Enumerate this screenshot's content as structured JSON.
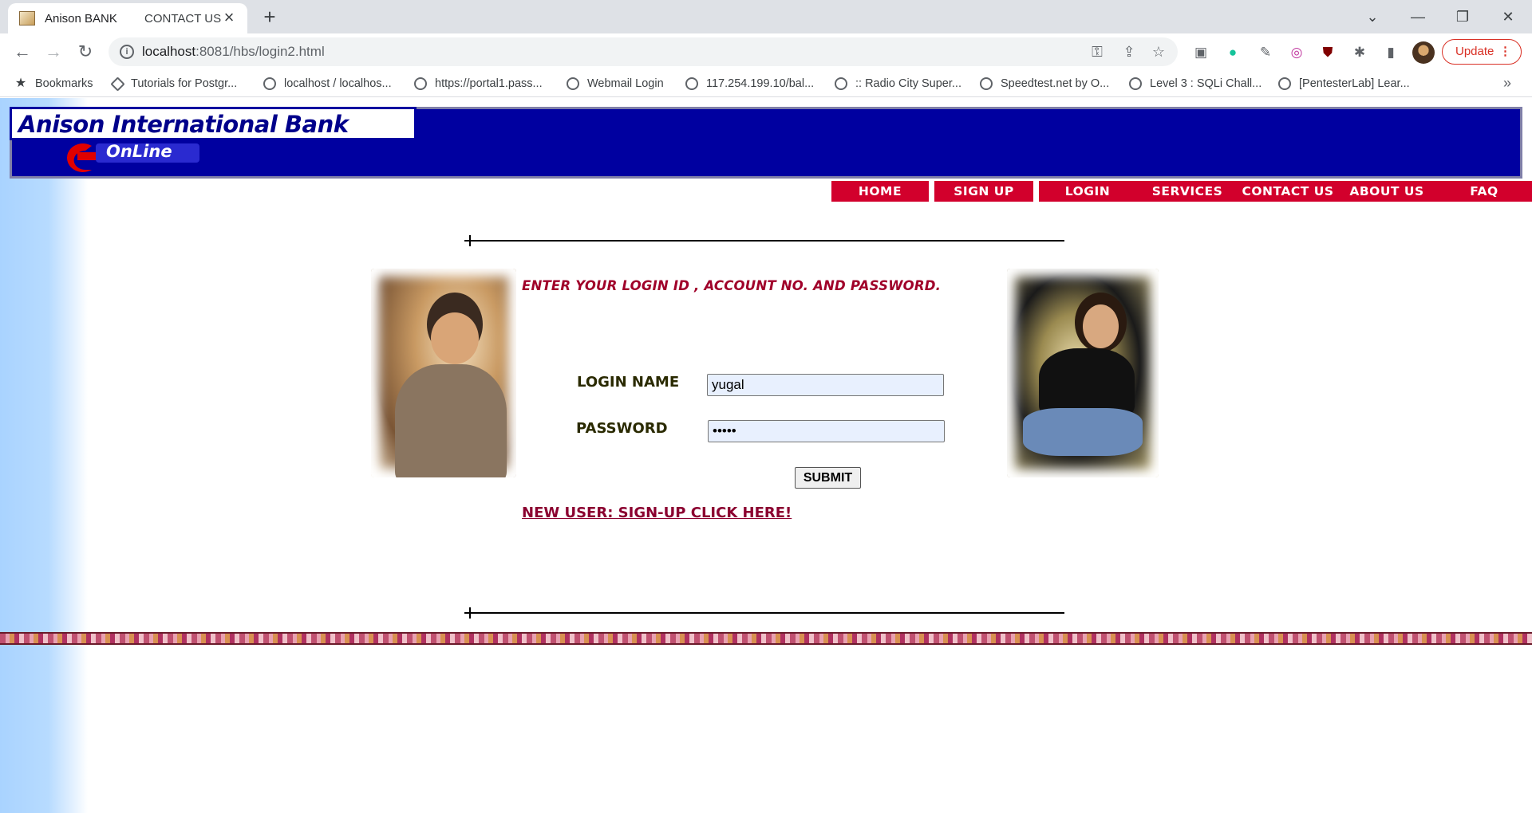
{
  "browser": {
    "tabs": [
      {
        "title": "Anison BANK",
        "subtitle": "CONTACT US"
      }
    ],
    "new_tab": "+",
    "window_controls": {
      "minimize": "—",
      "restore": "❐",
      "close": "✕",
      "tab_list": "⌄"
    },
    "url": {
      "host": "localhost",
      "rest": ":8081/hbs/login2.html"
    },
    "update_label": "Update",
    "bookmarks": [
      {
        "label": "Bookmarks",
        "icon": "star-icon"
      },
      {
        "label": "Tutorials for Postgr...",
        "icon": "diamond-icon"
      },
      {
        "label": "localhost / localhos...",
        "icon": "globe-icon"
      },
      {
        "label": "https://portal1.pass...",
        "icon": "globe-icon"
      },
      {
        "label": "Webmail Login",
        "icon": "globe-icon"
      },
      {
        "label": "117.254.199.10/bal...",
        "icon": "globe-icon"
      },
      {
        "label": ":: Radio City Super...",
        "icon": "globe-icon"
      },
      {
        "label": "Speedtest.net by O...",
        "icon": "globe-icon"
      },
      {
        "label": "Level 3 : SQLi Chall...",
        "icon": "globe-icon"
      },
      {
        "label": "[PentesterLab] Lear...",
        "icon": "globe-icon"
      }
    ]
  },
  "header": {
    "bank_name": "Anison International Bank",
    "online_label": "OnLine"
  },
  "nav": {
    "items": [
      "HOME",
      "SIGN UP",
      "LOGIN",
      "SERVICES",
      "CONTACT US",
      "ABOUT US",
      "FAQ"
    ]
  },
  "login": {
    "instruction": "ENTER YOUR LOGIN ID , ACCOUNT NO. AND PASSWORD.",
    "login_name_label": "LOGIN NAME",
    "login_name_value": "yugal",
    "password_label": "PASSWORD",
    "password_value": "•••••",
    "submit_label": "SUBMIT",
    "signup_link": "NEW USER: SIGN-UP CLICK HERE!"
  },
  "colors": {
    "banner": "#0000a0",
    "nav": "#d2002c",
    "instruction": "#a0002a"
  }
}
